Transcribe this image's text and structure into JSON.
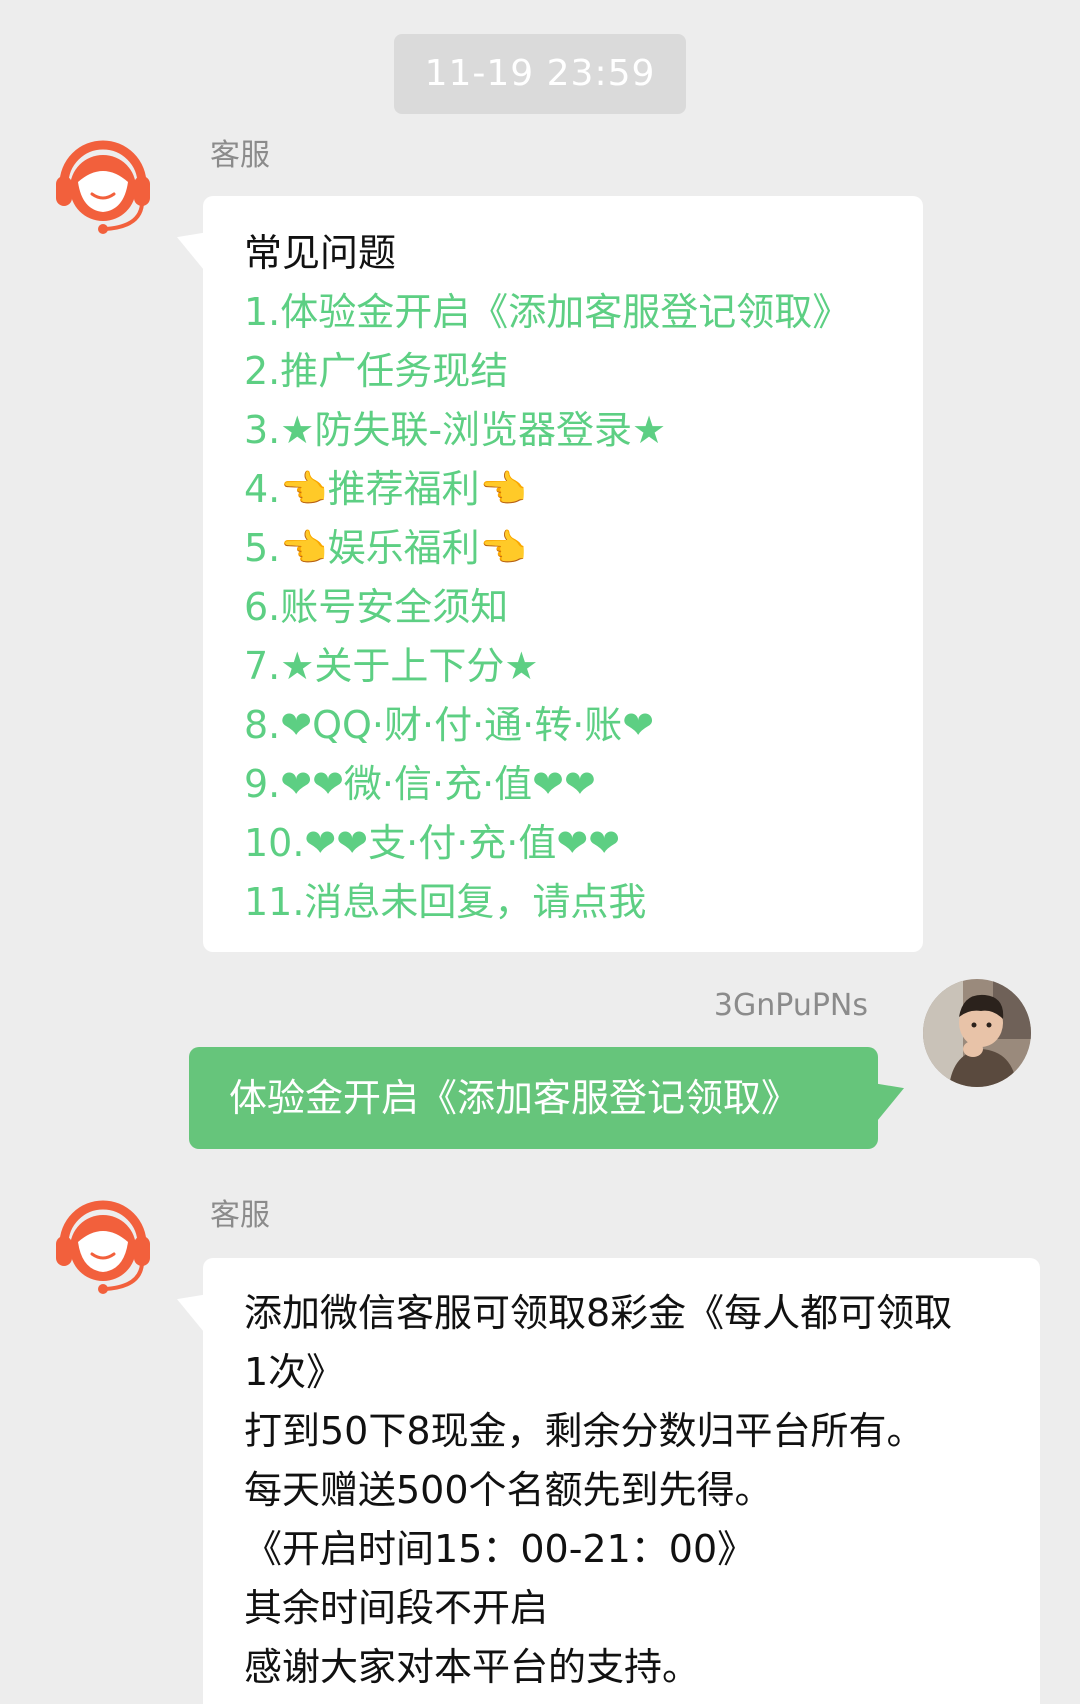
{
  "timestamp": "11-19 23:59",
  "messages": [
    {
      "sender": "客服",
      "title": "常见问题",
      "items": [
        "1.体验金开启《添加客服登记领取》",
        "2.推广任务现结",
        "3.★防失联-浏览器登录★",
        "4.👈推荐福利👈",
        "5.👈娱乐福利👈",
        "6.账号安全须知",
        "7.★关于上下分★",
        "8.❤QQ·财·付·通·转·账❤",
        "9.❤❤微·信·充·值❤❤",
        "10.❤❤支·付·充·值❤❤",
        "11.消息未回复，请点我"
      ]
    },
    {
      "sender": "3GnPuPNs",
      "text": "体验金开启《添加客服登记领取》"
    },
    {
      "sender": "客服",
      "lines": [
        "添加微信客服可领取8彩金《每人都可领取",
        "1次》",
        "打到50下8现金，剩余分数归平台所有。",
        "每天赠送500个名额先到先得。",
        "《开启时间15：00-21：00》",
        "其余时间段不开启",
        "感谢大家对本平台的支持。"
      ]
    }
  ],
  "icons": {
    "cs_avatar": "customer-service-headset-icon",
    "user_avatar": "user-avatar-photo"
  },
  "colors": {
    "link_green": "#5dcf83",
    "user_bubble": "#66c57b",
    "cs_orange": "#f2603c",
    "background": "#ededed"
  }
}
